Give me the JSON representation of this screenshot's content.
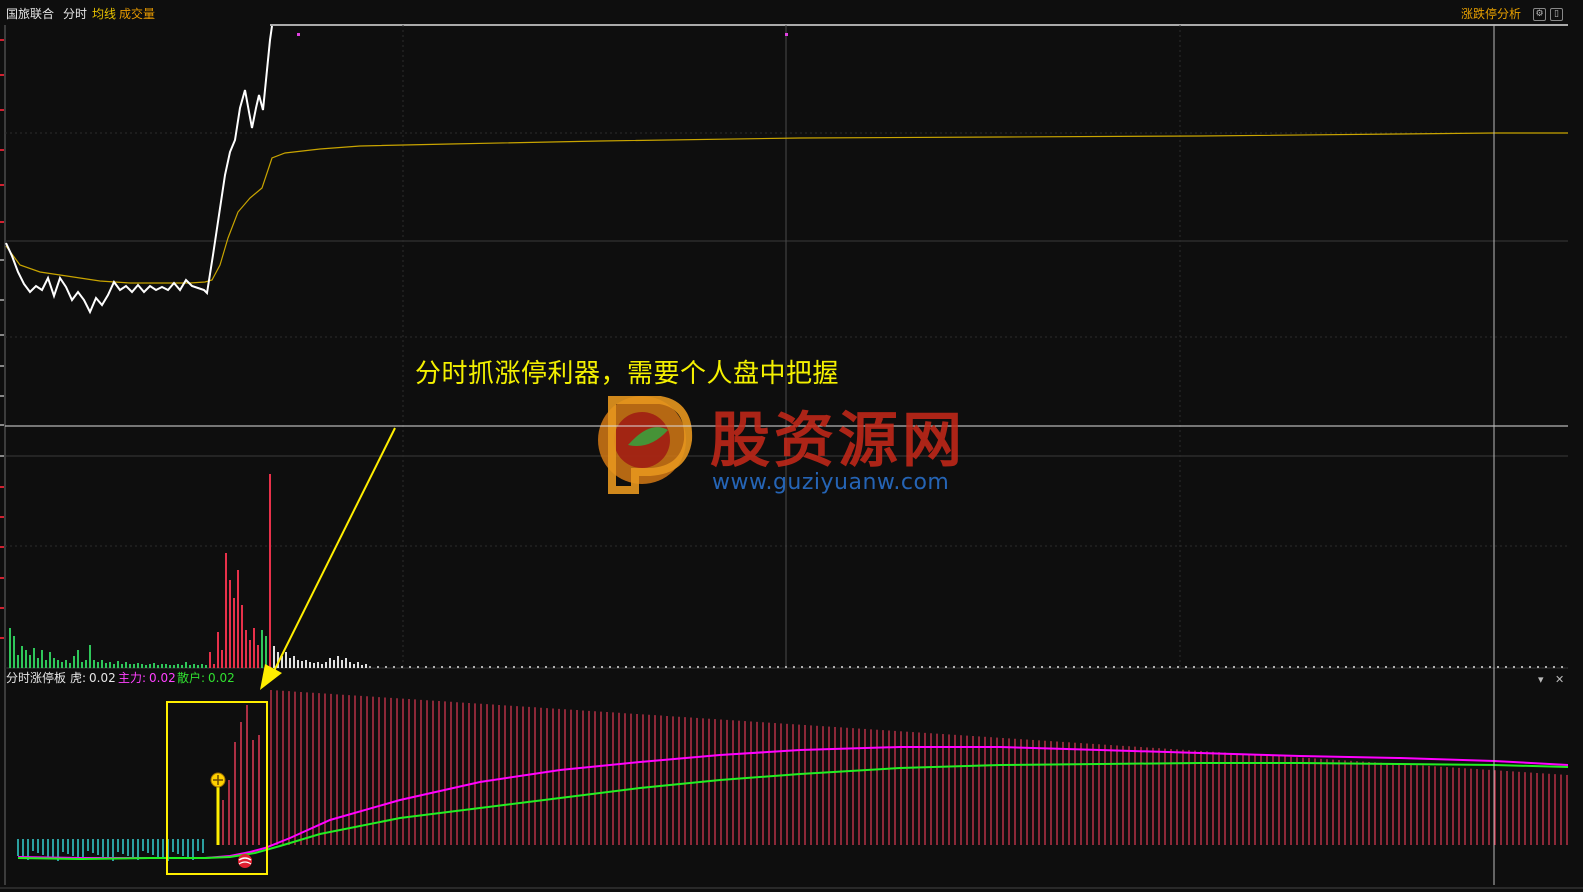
{
  "header": {
    "stock_name": "国旅联合",
    "mode_label": "分时",
    "avg_line_label": "均线",
    "volume_label": "成交量",
    "analysis_button": "涨跌停分析"
  },
  "indicator_header": {
    "name": "分时涨停板",
    "hu_label": "虎:",
    "hu_value": "0.02",
    "zhuli_label": "主力:",
    "zhuli_value": "0.02",
    "sanhu_label": "散户:",
    "sanhu_value": "0.02"
  },
  "annotation": "分时抓涨停利器，需要个人盘中把握",
  "watermark": {
    "title": "股资源网",
    "url": "www.guziyuanw.com"
  },
  "colors": {
    "price_line": "#ffffff",
    "avg_line": "#c8a400",
    "up_volume": "#e8314a",
    "down_volume": "#2fc75a",
    "flat_volume": "#e0e0e0",
    "zhuli_line": "#ff00ff",
    "sanhu_line": "#22ee22",
    "indicator_pos_bar": "#e03a55",
    "indicator_neg_bar": "#35d0d0",
    "highlight_box": "#ffee00",
    "annotation_text": "#f4f000"
  },
  "icons": {
    "settings": "gear-icon",
    "restore": "window-icon",
    "dropdown": "chevron-down-icon",
    "close": "close-icon",
    "signal": "crosshair-signal-icon",
    "ball": "red-ball-icon",
    "watermark_logo": "guziyuan-logo-icon"
  }
}
